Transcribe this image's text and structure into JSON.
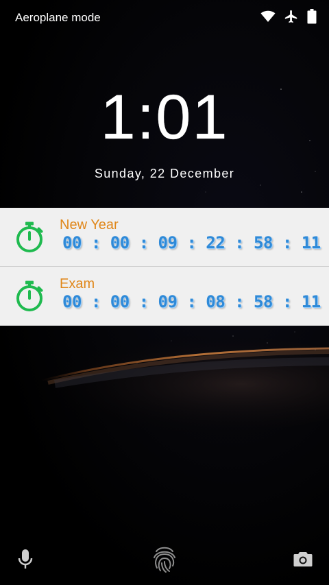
{
  "status_bar": {
    "label": "Aeroplane mode",
    "icons": [
      "wifi-icon",
      "airplane-icon",
      "battery-icon"
    ]
  },
  "lockscreen": {
    "time": "1:01",
    "date": "Sunday, 22 December"
  },
  "notifications": [
    {
      "icon": "stopwatch-icon",
      "title": "New Year",
      "countdown": "00 : 00 : 09 : 22 : 58 : 11"
    },
    {
      "icon": "stopwatch-icon",
      "title": "Exam",
      "countdown": "00 : 00 : 09 : 08 : 58 : 11"
    }
  ],
  "bottom_actions": [
    "microphone-icon",
    "fingerprint-icon",
    "camera-icon"
  ],
  "colors": {
    "notification_bg": "#f0f0f0",
    "title_orange": "#e0871a",
    "countdown_blue": "#2f8ad8",
    "stopwatch_green": "#1fba4f"
  }
}
